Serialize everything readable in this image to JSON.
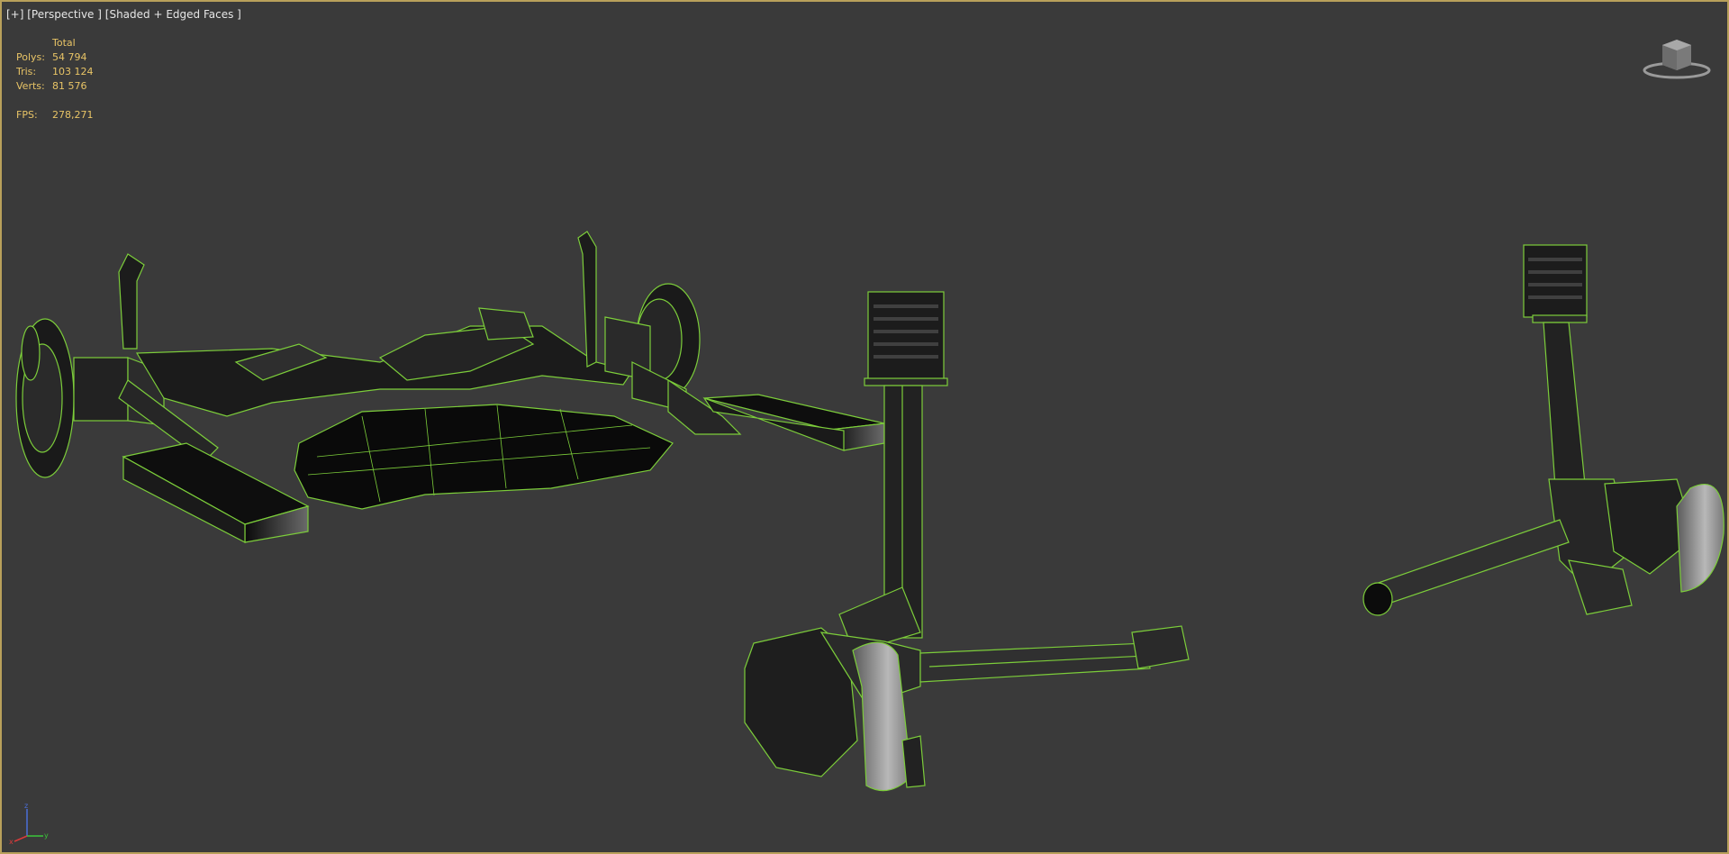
{
  "viewport": {
    "label_plus": "[+]",
    "label_view": "[Perspective ]",
    "label_shading": "[Shaded + Edged Faces ]"
  },
  "stats": {
    "header": "Total",
    "polys_label": "Polys:",
    "polys_value": "54 794",
    "tris_label": "Tris:",
    "tris_value": "103 124",
    "verts_label": "Verts:",
    "verts_value": "81 576",
    "fps_label": "FPS:",
    "fps_value": "278,271"
  },
  "axis": {
    "z": "z",
    "y": "y",
    "x": "x"
  },
  "colors": {
    "background": "#3a3a3a",
    "border_active": "#b8a05a",
    "stats_text": "#e8c466",
    "wire_edge": "#7ccd3a"
  },
  "icons": {
    "viewcube": "viewcube-icon",
    "axis_gizmo": "axis-tripod-icon"
  }
}
